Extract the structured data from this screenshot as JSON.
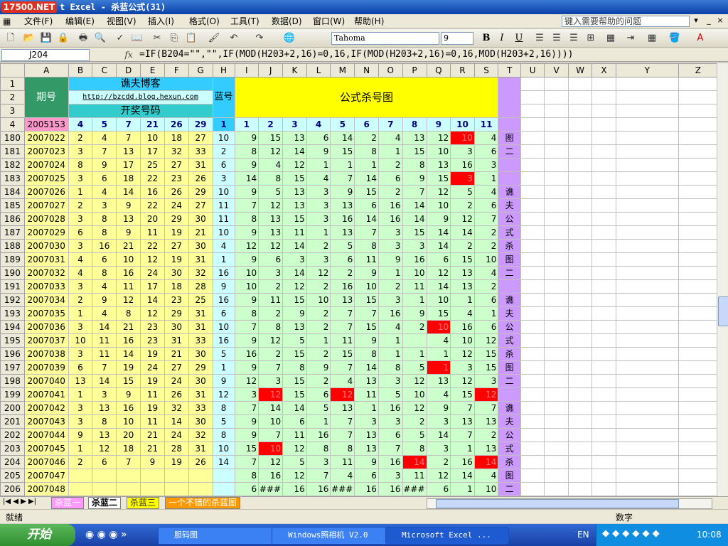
{
  "window": {
    "logo": "17500.NET",
    "title": "t Excel - 杀蓝公式(31)",
    "help_placeholder": "键入需要帮助的问题"
  },
  "menu": [
    "文件(F)",
    "编辑(E)",
    "视图(V)",
    "插入(I)",
    "格式(O)",
    "工具(T)",
    "数据(D)",
    "窗口(W)",
    "帮助(H)"
  ],
  "toolbar": {
    "font": "Tahoma",
    "size": "9",
    "bold": "B",
    "italic": "I",
    "underline": "U"
  },
  "formula_bar": {
    "cell": "J204",
    "fx": "fx",
    "formula": "=IF(B204=\"\",\"\",IF(MOD(H203+2,16)=0,16,IF(MOD(H203+2,16)=0,16,MOD(H203+2,16))))"
  },
  "columns": [
    "A",
    "B",
    "C",
    "D",
    "E",
    "F",
    "G",
    "H",
    "I",
    "J",
    "K",
    "L",
    "M",
    "N",
    "O",
    "P",
    "Q",
    "R",
    "S",
    "T",
    "U",
    "V",
    "W",
    "X",
    "Y",
    "Z"
  ],
  "header": {
    "period_label": "期号",
    "blog_title": "谯夫博客",
    "blog_url": "http://bzcdd.blog.hexun.com",
    "draw_label": "开奖号码",
    "blue_label": "蓝号",
    "kill_title": "公式杀号图",
    "row4": [
      "2005153",
      "4",
      "5",
      "7",
      "21",
      "26",
      "29",
      "1",
      "1",
      "2",
      "3",
      "4",
      "5",
      "6",
      "7",
      "8",
      "9",
      "10",
      "11"
    ]
  },
  "rows": [
    {
      "rn": "180",
      "p": "2007022",
      "n": [
        "2",
        "4",
        "7",
        "10",
        "18",
        "27"
      ],
      "b": "10",
      "k": [
        "9",
        "15",
        "13",
        "6",
        "14",
        "2",
        "4",
        "13",
        "12",
        "10",
        "4"
      ],
      "red": [
        9
      ]
    },
    {
      "rn": "181",
      "p": "2007023",
      "n": [
        "3",
        "7",
        "13",
        "17",
        "32",
        "33"
      ],
      "b": "2",
      "k": [
        "8",
        "12",
        "14",
        "9",
        "15",
        "8",
        "1",
        "15",
        "10",
        "3",
        "6"
      ],
      "red": []
    },
    {
      "rn": "182",
      "p": "2007024",
      "n": [
        "8",
        "9",
        "17",
        "25",
        "27",
        "31"
      ],
      "b": "6",
      "k": [
        "9",
        "4",
        "12",
        "1",
        "1",
        "1",
        "2",
        "8",
        "13",
        "16",
        "3"
      ],
      "red": []
    },
    {
      "rn": "183",
      "p": "2007025",
      "n": [
        "3",
        "6",
        "18",
        "22",
        "23",
        "26"
      ],
      "b": "3",
      "k": [
        "14",
        "8",
        "15",
        "4",
        "7",
        "14",
        "6",
        "9",
        "15",
        "3",
        "1"
      ],
      "red": [
        9
      ]
    },
    {
      "rn": "184",
      "p": "2007026",
      "n": [
        "1",
        "4",
        "14",
        "16",
        "26",
        "29"
      ],
      "b": "10",
      "k": [
        "9",
        "5",
        "13",
        "3",
        "9",
        "15",
        "2",
        "7",
        "12",
        "5",
        "4"
      ],
      "red": []
    },
    {
      "rn": "185",
      "p": "2007027",
      "n": [
        "2",
        "3",
        "9",
        "22",
        "24",
        "27"
      ],
      "b": "11",
      "k": [
        "7",
        "12",
        "13",
        "3",
        "13",
        "6",
        "16",
        "14",
        "10",
        "2",
        "6"
      ],
      "red": []
    },
    {
      "rn": "186",
      "p": "2007028",
      "n": [
        "3",
        "8",
        "13",
        "20",
        "29",
        "30"
      ],
      "b": "11",
      "k": [
        "8",
        "13",
        "15",
        "3",
        "16",
        "14",
        "16",
        "14",
        "9",
        "12",
        "7"
      ],
      "red": []
    },
    {
      "rn": "187",
      "p": "2007029",
      "n": [
        "6",
        "8",
        "9",
        "11",
        "19",
        "21"
      ],
      "b": "10",
      "k": [
        "9",
        "13",
        "11",
        "1",
        "13",
        "7",
        "3",
        "15",
        "14",
        "14",
        "2"
      ],
      "red": []
    },
    {
      "rn": "188",
      "p": "2007030",
      "n": [
        "3",
        "16",
        "21",
        "22",
        "27",
        "30"
      ],
      "b": "4",
      "k": [
        "12",
        "12",
        "14",
        "2",
        "5",
        "8",
        "3",
        "3",
        "14",
        "2",
        "2"
      ],
      "red": []
    },
    {
      "rn": "189",
      "p": "2007031",
      "n": [
        "4",
        "6",
        "10",
        "12",
        "19",
        "31"
      ],
      "b": "1",
      "k": [
        "9",
        "6",
        "3",
        "3",
        "6",
        "11",
        "9",
        "16",
        "6",
        "15",
        "10"
      ],
      "red": []
    },
    {
      "rn": "190",
      "p": "2007032",
      "n": [
        "4",
        "8",
        "16",
        "24",
        "30",
        "32"
      ],
      "b": "16",
      "k": [
        "10",
        "3",
        "14",
        "12",
        "2",
        "9",
        "1",
        "10",
        "12",
        "13",
        "4"
      ],
      "red": []
    },
    {
      "rn": "191",
      "p": "2007033",
      "n": [
        "3",
        "4",
        "11",
        "17",
        "18",
        "28"
      ],
      "b": "9",
      "k": [
        "10",
        "2",
        "12",
        "2",
        "16",
        "10",
        "2",
        "11",
        "14",
        "13",
        "2"
      ],
      "red": []
    },
    {
      "rn": "192",
      "p": "2007034",
      "n": [
        "2",
        "9",
        "12",
        "14",
        "23",
        "25"
      ],
      "b": "16",
      "k": [
        "9",
        "11",
        "15",
        "10",
        "13",
        "15",
        "3",
        "1",
        "10",
        "1",
        "6"
      ],
      "red": []
    },
    {
      "rn": "193",
      "p": "2007035",
      "n": [
        "1",
        "4",
        "8",
        "12",
        "29",
        "31"
      ],
      "b": "6",
      "k": [
        "8",
        "2",
        "9",
        "2",
        "7",
        "7",
        "16",
        "9",
        "15",
        "4",
        "1"
      ],
      "red": []
    },
    {
      "rn": "194",
      "p": "2007036",
      "n": [
        "3",
        "14",
        "21",
        "23",
        "30",
        "31"
      ],
      "b": "10",
      "k": [
        "7",
        "8",
        "13",
        "2",
        "7",
        "15",
        "4",
        "2",
        "10",
        "16",
        "6"
      ],
      "red": [
        8
      ]
    },
    {
      "rn": "195",
      "p": "2007037",
      "n": [
        "10",
        "11",
        "16",
        "23",
        "31",
        "33"
      ],
      "b": "16",
      "k": [
        "9",
        "12",
        "5",
        "1",
        "11",
        "9",
        "1",
        "",
        "4",
        "10",
        "12"
      ],
      "red": []
    },
    {
      "rn": "196",
      "p": "2007038",
      "n": [
        "3",
        "11",
        "14",
        "19",
        "21",
        "30"
      ],
      "b": "5",
      "k": [
        "16",
        "2",
        "15",
        "2",
        "15",
        "8",
        "1",
        "1",
        "1",
        "12",
        "15"
      ],
      "red": []
    },
    {
      "rn": "197",
      "p": "2007039",
      "n": [
        "6",
        "7",
        "19",
        "24",
        "27",
        "29"
      ],
      "b": "1",
      "k": [
        "9",
        "7",
        "8",
        "9",
        "7",
        "14",
        "8",
        "5",
        "1",
        "3",
        "15"
      ],
      "red": [
        8
      ]
    },
    {
      "rn": "198",
      "p": "2007040",
      "n": [
        "13",
        "14",
        "15",
        "19",
        "24",
        "30"
      ],
      "b": "9",
      "k": [
        "12",
        "3",
        "15",
        "2",
        "4",
        "13",
        "3",
        "12",
        "13",
        "12",
        "3"
      ],
      "red": []
    },
    {
      "rn": "199",
      "p": "2007041",
      "n": [
        "1",
        "3",
        "9",
        "11",
        "26",
        "31"
      ],
      "b": "12",
      "k": [
        "3",
        "12",
        "15",
        "6",
        "12",
        "11",
        "5",
        "10",
        "4",
        "15",
        "12"
      ],
      "red": [
        1,
        4,
        10
      ]
    },
    {
      "rn": "200",
      "p": "2007042",
      "n": [
        "3",
        "13",
        "16",
        "19",
        "32",
        "33"
      ],
      "b": "8",
      "k": [
        "7",
        "14",
        "14",
        "5",
        "13",
        "1",
        "16",
        "12",
        "9",
        "7",
        "7"
      ],
      "red": []
    },
    {
      "rn": "201",
      "p": "2007043",
      "n": [
        "3",
        "8",
        "10",
        "11",
        "14",
        "30"
      ],
      "b": "5",
      "k": [
        "9",
        "10",
        "6",
        "1",
        "7",
        "3",
        "3",
        "2",
        "3",
        "13",
        "13"
      ],
      "red": []
    },
    {
      "rn": "202",
      "p": "2007044",
      "n": [
        "9",
        "13",
        "20",
        "21",
        "24",
        "32"
      ],
      "b": "8",
      "k": [
        "9",
        "7",
        "11",
        "16",
        "7",
        "13",
        "6",
        "5",
        "14",
        "7",
        "2"
      ],
      "red": []
    },
    {
      "rn": "203",
      "p": "2007045",
      "n": [
        "1",
        "12",
        "18",
        "21",
        "28",
        "31"
      ],
      "b": "10",
      "k": [
        "15",
        "10",
        "12",
        "8",
        "8",
        "13",
        "7",
        "8",
        "3",
        "1",
        "13"
      ],
      "red": [
        1
      ]
    },
    {
      "rn": "204",
      "p": "2007046",
      "n": [
        "2",
        "6",
        "7",
        "9",
        "19",
        "26"
      ],
      "b": "14",
      "k": [
        "7",
        "12",
        "5",
        "3",
        "11",
        "9",
        "16",
        "14",
        "2",
        "16",
        "14"
      ],
      "red": [
        7,
        10
      ]
    },
    {
      "rn": "205",
      "p": "2007047",
      "n": [
        "",
        "",
        "",
        "",
        "",
        ""
      ],
      "b": "",
      "k": [
        "8",
        "16",
        "12",
        "7",
        "4",
        "6",
        "3",
        "11",
        "12",
        "14",
        "4"
      ],
      "red": []
    },
    {
      "rn": "206",
      "p": "2007048",
      "n": [
        "",
        "",
        "",
        "",
        "",
        ""
      ],
      "b": "",
      "k": [
        "6",
        "###",
        "16",
        "16",
        "###",
        "16",
        "16",
        "###",
        "6",
        "1",
        "10"
      ],
      "red": []
    }
  ],
  "side_text": [
    "图",
    "二",
    "",
    "",
    "谯",
    "夫",
    "公",
    "式",
    "杀",
    "图",
    "二",
    "",
    "谯",
    "夫",
    "公",
    "式",
    "杀",
    "图",
    "二",
    "",
    "谯",
    "夫",
    "公",
    "式",
    "杀",
    "图",
    "二"
  ],
  "sheet_tabs": [
    "杀蓝一",
    "杀蓝二",
    "杀蓝三",
    "一个不错的杀蓝图"
  ],
  "status": {
    "ready": "就绪",
    "mode": "数字"
  },
  "taskbar": {
    "start": "开始",
    "items": [
      "胆码图",
      "Windows照相机 V2.0",
      "Microsoft Excel ..."
    ],
    "lang": "EN",
    "clock": "10:08"
  },
  "colors": {
    "yellow": "#ffff99",
    "cyan": "#ccffff",
    "green": "#ccffcc",
    "red": "#ff0000",
    "purple": "#cc99ff",
    "title_yellow": "#ffff00",
    "header_blue": "#33ccff",
    "period_green": "#339966"
  }
}
